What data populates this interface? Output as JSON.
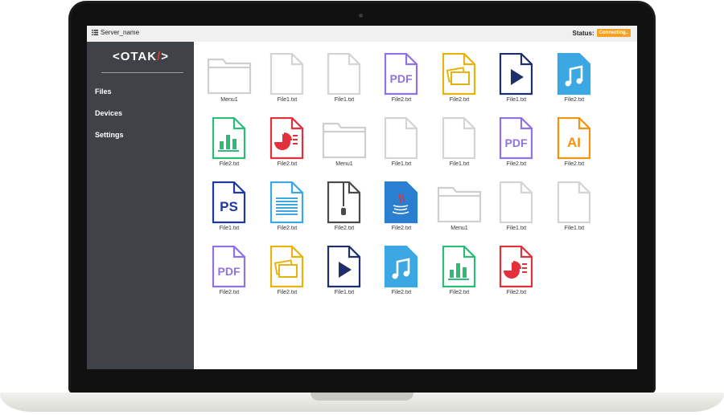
{
  "header": {
    "server_name": "Server_name",
    "status_label": "Status:",
    "status_badge": "Connecting..",
    "status_color": "#f4a223"
  },
  "sidebar": {
    "logo": {
      "pre": "<OTAK",
      "slash": "/",
      "post": ">"
    },
    "items": [
      {
        "label": "Files"
      },
      {
        "label": "Devices"
      },
      {
        "label": "Settings"
      }
    ]
  },
  "files": [
    {
      "type": "folder",
      "label": "Menu1"
    },
    {
      "type": "blank",
      "label": "File1.txt"
    },
    {
      "type": "blank",
      "label": "File1.txt"
    },
    {
      "type": "pdf",
      "label": "File2.txt"
    },
    {
      "type": "image",
      "label": "File2.txt"
    },
    {
      "type": "video",
      "label": "File1.txt"
    },
    {
      "type": "audio",
      "label": "File2.txt"
    },
    {
      "type": "chart",
      "label": "File2.txt"
    },
    {
      "type": "presentation",
      "label": "File2.txt"
    },
    {
      "type": "folder",
      "label": "Menu1"
    },
    {
      "type": "blank",
      "label": "File1.txt"
    },
    {
      "type": "blank",
      "label": "File1.txt"
    },
    {
      "type": "pdf",
      "label": "File2.txt"
    },
    {
      "type": "ai",
      "label": "File2.txt"
    },
    {
      "type": "ps",
      "label": "File1.txt"
    },
    {
      "type": "text",
      "label": "File2.txt"
    },
    {
      "type": "zip",
      "label": "File2.txt"
    },
    {
      "type": "java",
      "label": "File2.txt"
    },
    {
      "type": "folder",
      "label": "Menu1"
    },
    {
      "type": "blank",
      "label": "File1.txt"
    },
    {
      "type": "blank",
      "label": "File1.txt"
    },
    {
      "type": "pdf",
      "label": "File2.txt"
    },
    {
      "type": "image",
      "label": "File2.txt"
    },
    {
      "type": "video",
      "label": "File1.txt"
    },
    {
      "type": "audio",
      "label": "File2.txt"
    },
    {
      "type": "chart",
      "label": "File2.txt"
    },
    {
      "type": "presentation",
      "label": "File2.txt"
    }
  ],
  "type_styles": {
    "folder": {
      "color": "#cfcfcf",
      "icon": "folder-icon"
    },
    "blank": {
      "color": "#d4d4d4",
      "icon": "blank-file-icon"
    },
    "pdf": {
      "color": "#8f73e6",
      "icon": "pdf-file-icon",
      "text": "PDF"
    },
    "image": {
      "color": "#e8b30f",
      "icon": "image-file-icon"
    },
    "video": {
      "color": "#1f2f6b",
      "icon": "video-file-icon"
    },
    "audio": {
      "color": "#3ba7e3",
      "icon": "audio-file-icon"
    },
    "chart": {
      "color": "#2dbb7a",
      "icon": "chart-file-icon"
    },
    "presentation": {
      "color": "#e3313b",
      "icon": "presentation-file-icon"
    },
    "ai": {
      "color": "#f0950f",
      "icon": "ai-file-icon",
      "text": "AI"
    },
    "ps": {
      "color": "#1e3aa0",
      "icon": "ps-file-icon",
      "text": "PS"
    },
    "text": {
      "color": "#3ba7e3",
      "icon": "text-file-icon"
    },
    "zip": {
      "color": "#4a4a4a",
      "icon": "zip-file-icon"
    },
    "java": {
      "color": "#2b7fd1",
      "icon": "java-file-icon"
    }
  }
}
